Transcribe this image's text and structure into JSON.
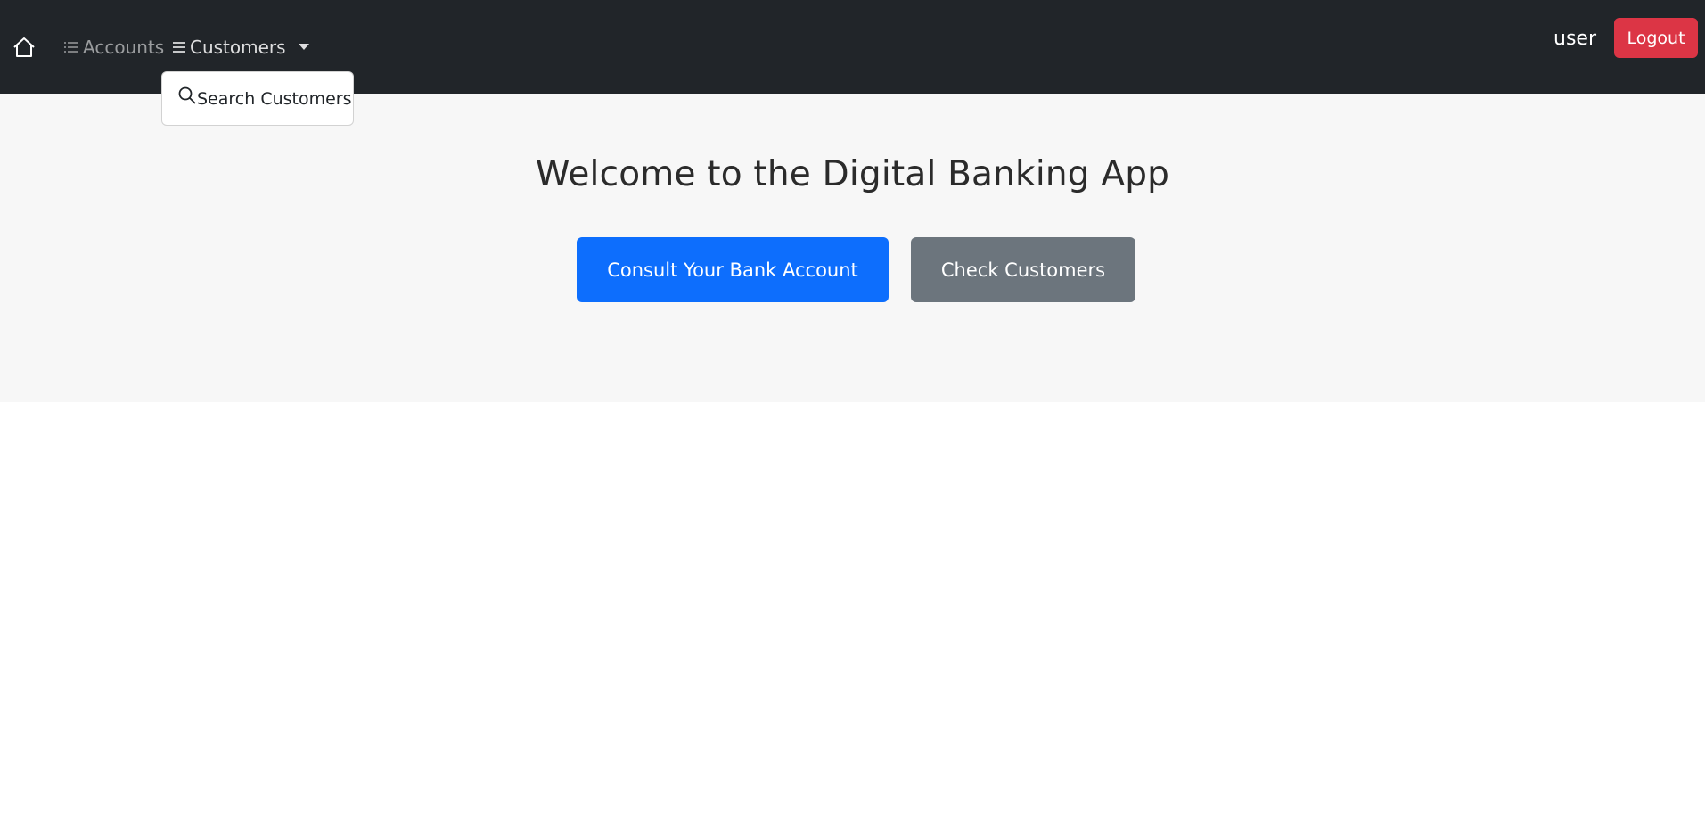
{
  "navbar": {
    "home_icon": "house-icon",
    "accounts_icon": "list-icon",
    "accounts_label": "Accounts",
    "customers_icon": "menu-icon",
    "customers_label": "Customers",
    "username": "user",
    "logout_label": "Logout"
  },
  "dropdown": {
    "items": [
      {
        "icon": "search-icon",
        "label": "Search Customers"
      }
    ]
  },
  "hero": {
    "title": "Welcome to the Digital Banking App",
    "primary_button": "Consult Your Bank Account",
    "secondary_button": "Check Customers"
  },
  "colors": {
    "navbar_bg": "#212529",
    "hero_bg": "#f7f7f7",
    "primary": "#0d6efd",
    "secondary": "#6c757d",
    "danger": "#dc3545"
  }
}
